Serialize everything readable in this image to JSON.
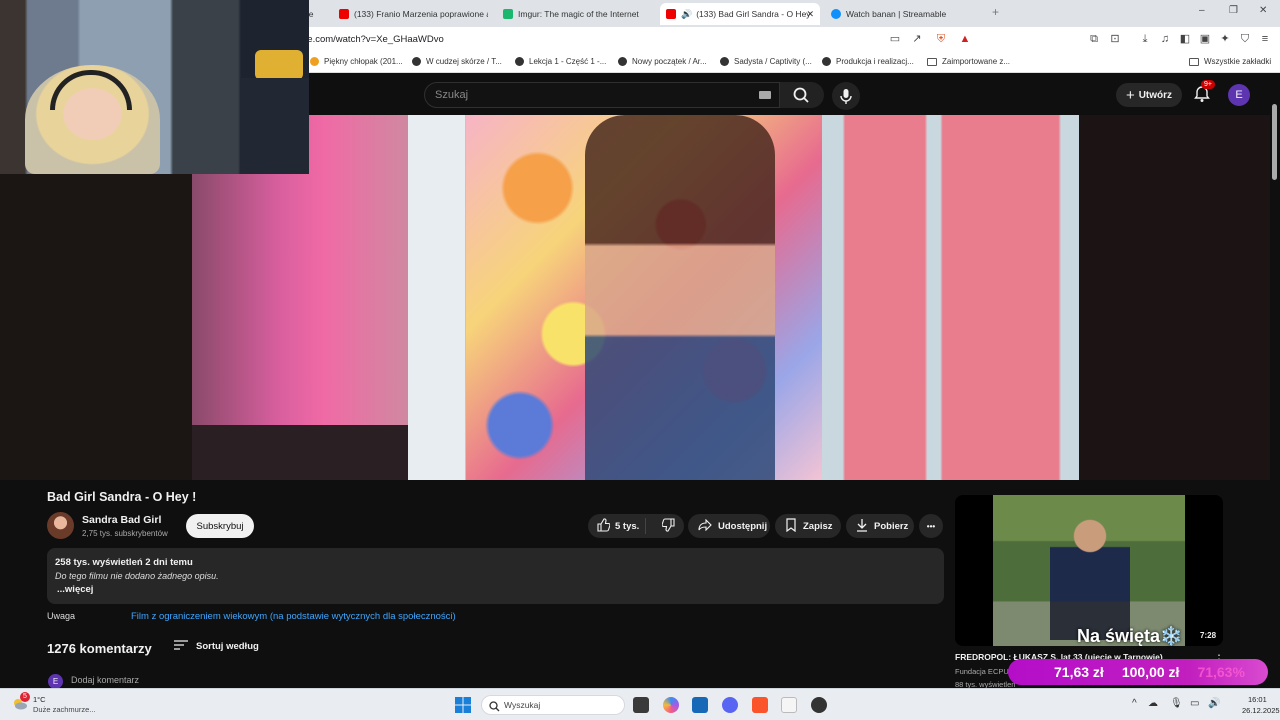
{
  "browser": {
    "tabs": [
      {
        "label": "ge",
        "active": false
      },
      {
        "label": "(133) Franio Marzenia poprawione ar",
        "active": false
      },
      {
        "label": "Imgur: The magic of the Internet",
        "active": false
      },
      {
        "label": "(133) Bad Girl Sandra - O Hey",
        "active": true
      },
      {
        "label": "Watch banan | Streamable",
        "active": false
      }
    ],
    "new_tab": "+",
    "url": "pe.com/watch?v=Xe_GHaaWDvo",
    "bookmarks": [
      "Piękny chłopak (201...",
      "W cudzej skórze / T...",
      "Lekcja 1 - Część 1 -...",
      "Nowy początek / Ar...",
      "Sadysta / Captivity (...",
      "Produkcja i realizacj...",
      "Zaimportowane z...",
      "Wszystkie zakładki"
    ],
    "window_controls": [
      "–",
      "❐",
      "✕"
    ]
  },
  "youtube": {
    "search_placeholder": "Szukaj",
    "create_label": "Utwórz",
    "notifications_badge": "9+",
    "avatar_letter": "E"
  },
  "video": {
    "title": "Bad Girl Sandra - O Hey !",
    "channel": "Sandra Bad Girl",
    "subscribers": "2,75 tys. subskrybentów",
    "subscribe_label": "Subskrybuj",
    "likes": "5 tys.",
    "share_label": "Udostępnij",
    "save_label": "Zapisz",
    "download_label": "Pobierz",
    "more_label": "•••",
    "stats": "258 tys. wyświetleń  2 dni temu",
    "description": "Do tego filmu nie dodano żadnego opisu.",
    "more_desc": "...więcej",
    "warning_label": "Uwaga",
    "warning_link": "Film z ograniczeniem wiekowym (na podstawie wytycznych dla społeczności)",
    "comments_count": "1276 komentarzy",
    "sort_label": "Sortuj według",
    "add_comment": "Dodaj komentarz",
    "commenter_letter": "E"
  },
  "recommended": {
    "title": "FREDROPOL: ŁUKASZ S. lat 33 (ujęcie w Tarnowie)",
    "channel": "Fundacja ECPU",
    "meta": "88 tys. wyświetleń",
    "duration": "7:28",
    "overlay": "Na święta❄️"
  },
  "donation": {
    "amount1": "71,63 zł",
    "amount2": "100,00 zł",
    "ghost": "71,63%"
  },
  "taskbar": {
    "weather_temp": "1°C",
    "weather_desc": "Duże zachmurze...",
    "weather_badge": "5",
    "search_placeholder": "Wyszukaj",
    "time": "16:01",
    "date": "26.12.2025"
  }
}
